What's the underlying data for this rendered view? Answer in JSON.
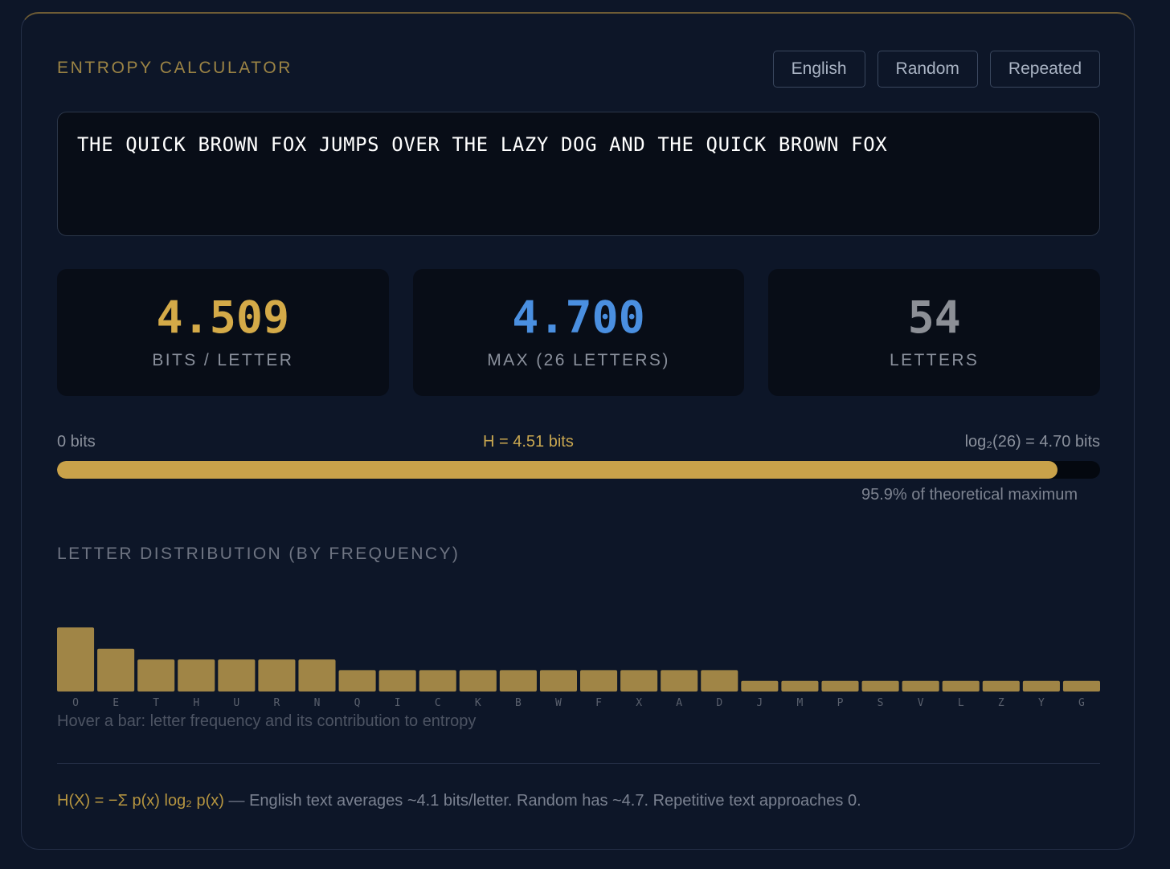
{
  "header": {
    "title": "ENTROPY CALCULATOR",
    "presets": [
      "English",
      "Random",
      "Repeated"
    ]
  },
  "input": {
    "value": "THE QUICK BROWN FOX JUMPS OVER THE LAZY DOG AND THE QUICK BROWN FOX"
  },
  "stats": [
    {
      "value": "4.509",
      "label": "BITS / LETTER",
      "color": "#d4aa48"
    },
    {
      "value": "4.700",
      "label": "MAX (26 LETTERS)",
      "color": "#4a8fe0"
    },
    {
      "value": "54",
      "label": "LETTERS",
      "color": "#8c8f96"
    }
  ],
  "gauge": {
    "min_label": "0 bits",
    "current_label": "H = 4.51 bits",
    "max_label": "log₂(26) = 4.70 bits",
    "fraction": 0.959,
    "percent_label": "95.9% of theoretical maximum"
  },
  "distribution": {
    "title": "LETTER DISTRIBUTION (BY FREQUENCY)",
    "hint": "Hover a bar: letter frequency and its contribution to entropy"
  },
  "chart_data": {
    "type": "bar",
    "title": "LETTER DISTRIBUTION (BY FREQUENCY)",
    "categories": [
      "O",
      "E",
      "T",
      "H",
      "U",
      "R",
      "N",
      "Q",
      "I",
      "C",
      "K",
      "B",
      "W",
      "F",
      "X",
      "A",
      "D",
      "J",
      "M",
      "P",
      "S",
      "V",
      "L",
      "Z",
      "Y",
      "G"
    ],
    "values": [
      6,
      4,
      3,
      3,
      3,
      3,
      3,
      2,
      2,
      2,
      2,
      2,
      2,
      2,
      2,
      2,
      2,
      1,
      1,
      1,
      1,
      1,
      1,
      1,
      1,
      1
    ],
    "bar_color": "#a08546",
    "xlabel": "",
    "ylabel": ""
  },
  "footer": {
    "formula": "H(X) = −Σ p(x) log₂ p(x)",
    "dash": "—",
    "note": "English text averages ~4.1 bits/letter. Random has ~4.7. Repetitive text approaches 0."
  },
  "colors": {
    "background": "#0d1628",
    "gold": "#c9a24a",
    "blue": "#4a8fe0",
    "panel": "#080d17"
  }
}
